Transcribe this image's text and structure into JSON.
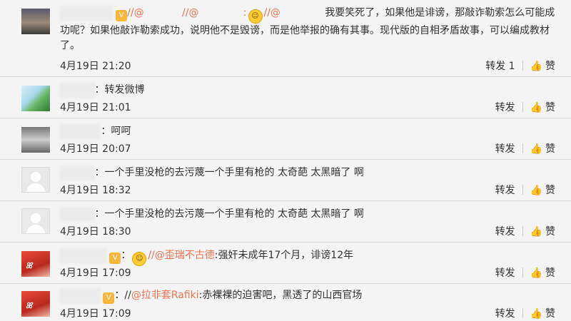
{
  "comments": [
    {
      "avatar": "photo-avatar",
      "name": "                ",
      "mention1": "//@            ",
      "mention2": "//@              :",
      "mention3": "//@              ",
      "text": "我要笑死了，如果他是诽谤，那敲诈勒索怎么可能成功呢？如果他敲诈勒索成功，说明他不是毁谤，而是他举报的确有其事。现代版的自相矛盾故事，可以编成教材了。",
      "time": "4月19日 21:20",
      "repost": "转发 1",
      "like": "赞"
    },
    {
      "avatar": "plant-avatar",
      "name": "          ",
      "text": "：转发微博",
      "time": "4月19日 21:01",
      "repost": "转发",
      "like": "赞"
    },
    {
      "avatar": "bw-avatar",
      "name": "            ",
      "text": "：呵呵",
      "time": "4月19日 20:07",
      "repost": "转发",
      "like": "赞"
    },
    {
      "avatar": "default-avatar",
      "name": "          ",
      "text": "：一个手里没枪的去污蔑一个手里有枪的 太奇葩 太黑暗了 啊",
      "time": "4月19日 18:32",
      "repost": "转发",
      "like": "赞"
    },
    {
      "avatar": "default-avatar",
      "name": "          ",
      "text": "：一个手里没枪的去污蔑一个手里有枪的  太奇葩 太黑暗了 啊",
      "time": "4月19日 18:30",
      "repost": "转发",
      "like": "赞"
    },
    {
      "avatar": "red-avatar",
      "name": "              ",
      "mention": "//@歪瑞不古德",
      "text": ":强奸未成年17个月，诽谤12年",
      "time": "4月19日 17:09",
      "repost": "转发",
      "like": "赞"
    },
    {
      "avatar": "red-avatar",
      "name": "            ",
      "prefix": "：//",
      "mention": "@拉非套Rafiki",
      "text": ":赤裸裸的迫害吧，黑透了的山西官场",
      "time": "4月19日 17:09",
      "repost": "转发",
      "like": "赞"
    }
  ],
  "colors": {
    "link": "#eb7350",
    "text": "#333333",
    "background": "#f4f4f4",
    "divider": "#dcdcdc"
  }
}
